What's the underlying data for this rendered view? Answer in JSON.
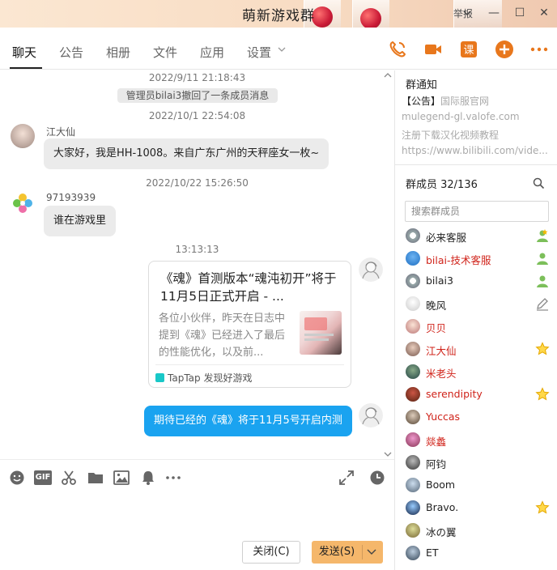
{
  "window": {
    "title": "萌新游戏群",
    "report_label": "举报",
    "minimize": "—",
    "maximize": "☐",
    "close": "✕"
  },
  "tabs": [
    {
      "label": "聊天",
      "active": true
    },
    {
      "label": "公告"
    },
    {
      "label": "相册"
    },
    {
      "label": "文件"
    },
    {
      "label": "应用"
    },
    {
      "label": "设置"
    }
  ],
  "actions": [
    "phone-icon",
    "video-call-icon",
    "class-icon",
    "add-icon",
    "more-icon"
  ],
  "accent_color": "#e8771c",
  "messages": {
    "ts1": "2022/9/11 21:18:43",
    "system_msg": "管理员bilai3撤回了一条成员消息",
    "ts2": "2022/10/1 22:54:08",
    "msg1": {
      "sender": "江大仙",
      "text": "大家好，我是HH-1008。来自广东广州的天秤座女一枚~"
    },
    "ts3": "2022/10/22 15:26:50",
    "msg2": {
      "sender": "97193939",
      "text": "谁在游戏里"
    },
    "ts4": "13:13:13",
    "card": {
      "title": "《魂》首测版本“魂沌初开”将于11月5日正式开启 - ...",
      "desc": "各位小伙伴，昨天在日志中提到《魂》已经进入了最后的性能优化，以及前...",
      "source": "TapTap 发现好游戏"
    },
    "msg_self": "期待已经的《魂》将于11月5号开启内测"
  },
  "toolbar": {
    "tools": [
      "emoji-icon",
      "gif-icon",
      "scissors-icon",
      "folder-icon",
      "image-icon",
      "bell-icon",
      "more-icon",
      "expand-icon",
      "history-icon"
    ],
    "gif_label": "GIF",
    "close_label": "关闭(C)",
    "send_label": "发送(S)"
  },
  "sidebar": {
    "notice_title": "群通知",
    "notice_lines": [
      "【公告】国际服官网",
      "mulegend-gl.valofe.com",
      "注册下载汉化视频教程",
      "https://www.bilibili.com/vide..."
    ],
    "notice_tag": "【公告】",
    "notice_first_rest": "国际服官网",
    "members_title": "群成员 32/136",
    "search_placeholder": "搜索群成员",
    "members": [
      {
        "name": "必来客服",
        "red": false,
        "badge": "owner-icon"
      },
      {
        "name": "bilai-技术客服",
        "red": true,
        "badge": "admin-icon"
      },
      {
        "name": "bilai3",
        "red": false,
        "badge": "admin-icon"
      },
      {
        "name": "晚风",
        "red": false,
        "badge": "edit-icon"
      },
      {
        "name": "贝贝",
        "red": true,
        "badge": ""
      },
      {
        "name": "江大仙",
        "red": true,
        "badge": "star-icon"
      },
      {
        "name": "米老头",
        "red": true,
        "badge": ""
      },
      {
        "name": "serendipity",
        "red": true,
        "badge": "star-icon"
      },
      {
        "name": "Yuccas",
        "red": true,
        "badge": ""
      },
      {
        "name": "燚蠡",
        "red": true,
        "badge": ""
      },
      {
        "name": "阿钧",
        "red": false,
        "badge": ""
      },
      {
        "name": "Boom",
        "red": false,
        "badge": ""
      },
      {
        "name": "Bravo.",
        "red": false,
        "badge": "star-icon"
      },
      {
        "name": "冰の翼",
        "red": false,
        "badge": ""
      },
      {
        "name": "ET",
        "red": false,
        "badge": ""
      }
    ]
  }
}
